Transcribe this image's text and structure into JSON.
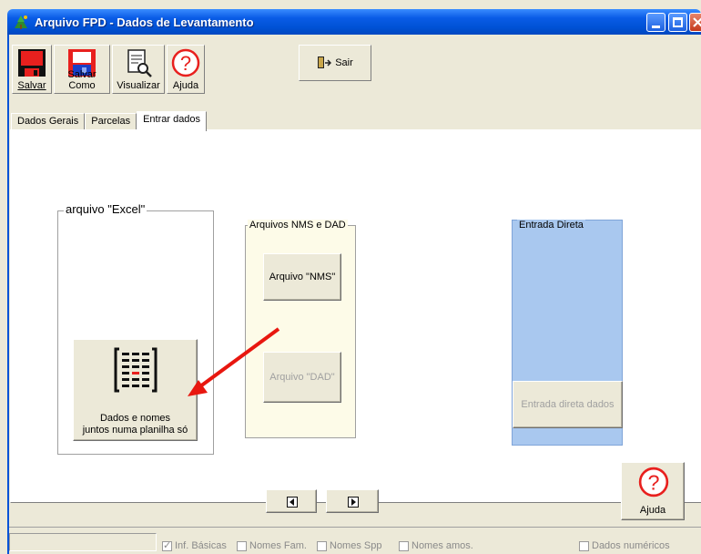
{
  "window": {
    "title": "Arquivo FPD - Dados de Levantamento"
  },
  "toolbar": {
    "salvar": "Salvar",
    "salvar_como": "Salvar Como",
    "visualizar": "Visualizar",
    "ajuda": "Ajuda",
    "sair": "Sair"
  },
  "tabs": [
    "Dados Gerais",
    "Parcelas",
    "Entrar dados"
  ],
  "excel_group": {
    "title": "arquivo \"Excel\"",
    "button_line1": "Dados e nomes",
    "button_line2": "juntos numa planilha só"
  },
  "nms_group": {
    "title": "Arquivos NMS e DAD",
    "nms_button": "Arquivo \"NMS\"",
    "dad_button": "Arquivo \"DAD\""
  },
  "direct_group": {
    "title": "Entrada Direta",
    "button": "Entrada direta dados"
  },
  "help_button": "Ajuda",
  "status_checks": [
    {
      "label": "Inf. Básicas",
      "checked": true
    },
    {
      "label": "Nomes Fam.",
      "checked": false
    },
    {
      "label": "Nomes Spp",
      "checked": false
    },
    {
      "label": "Nomes amos.",
      "checked": false
    },
    {
      "label": "Dados numéricos",
      "checked": false
    }
  ],
  "colors": {
    "accent": "#0052d6",
    "direct_panel": "#a9c8ef",
    "nms_panel": "#fdfbe8",
    "arrow": "#e8170f"
  }
}
